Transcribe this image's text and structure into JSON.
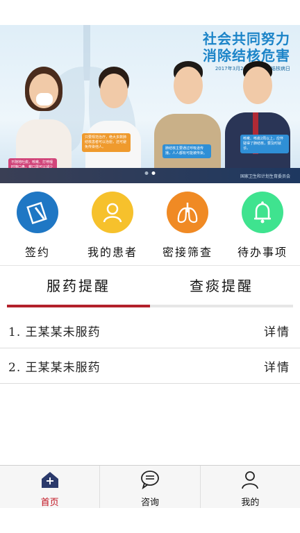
{
  "banner": {
    "title_line1": "社会共同努力",
    "title_line2": "消除结核危害",
    "subtitle": "2017年3月24日世界防治结核病日",
    "footnote": "国家卫生和计划生育委员会",
    "slide_count": 2,
    "active_slide": 1,
    "bubbles": [
      "不随地吐痰，咳嗽、打喷嚏时掩口鼻，戴口罩可以减少肺结核的传播。",
      "只要规范治疗，绝大多数肺结核患者可以治愈，还可避免传染他人。",
      "肺结核主要通过呼吸道传播，人人都有可能被传染。",
      "咳嗽、咳痰2周以上，应怀疑得了肺结核，要及时就诊。"
    ]
  },
  "actions": [
    {
      "label": "签约",
      "icon": "contract-icon",
      "color": "#1f77c4"
    },
    {
      "label": "我的患者",
      "icon": "user-icon",
      "color": "#f6c12c"
    },
    {
      "label": "密接筛查",
      "icon": "lungs-icon",
      "color": "#f08a24"
    },
    {
      "label": "待办事项",
      "icon": "bell-icon",
      "color": "#3fe38f"
    }
  ],
  "tabs": {
    "left": "服药提醒",
    "right": "查痰提醒",
    "active": "left"
  },
  "list": [
    {
      "index": "1.",
      "name": "王某某未服药",
      "action": "详情"
    },
    {
      "index": "2.",
      "name": "王某某未服药",
      "action": "详情"
    }
  ],
  "nav": [
    {
      "label": "首页",
      "icon": "home-icon",
      "active": true
    },
    {
      "label": "咨询",
      "icon": "chat-icon",
      "active": false
    },
    {
      "label": "我的",
      "icon": "profile-icon",
      "active": false
    }
  ],
  "colors": {
    "accent": "#b3202b",
    "active_nav": "#c0101e",
    "banner_title": "#1c84c8"
  }
}
